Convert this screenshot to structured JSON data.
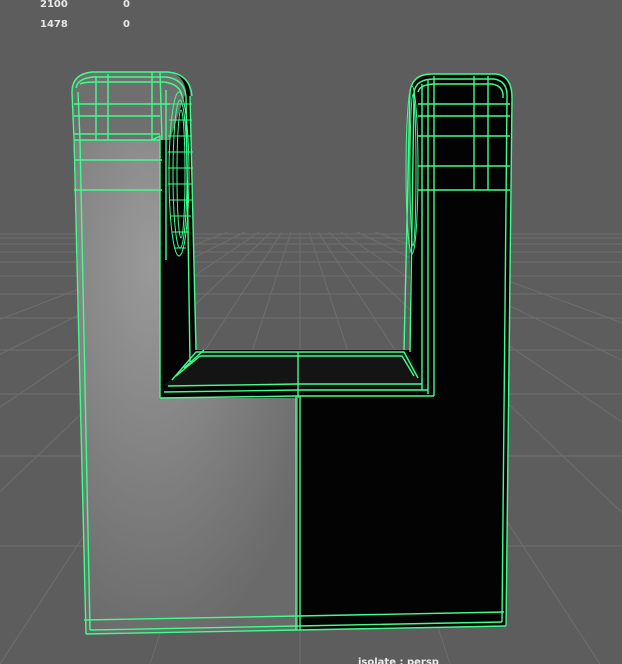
{
  "heads_up_display": {
    "rows": [
      {
        "label": "2100",
        "value": "0"
      },
      {
        "label": "1478",
        "value": "0"
      }
    ]
  },
  "viewport": {
    "caption": "isolate : persp",
    "background_color": "#5d5d5d",
    "grid_color": "#6e6e6e",
    "wireframe_color": "#3dff8c",
    "object_dark_color": "#000000",
    "object_light_color": "#8a8a8a"
  }
}
